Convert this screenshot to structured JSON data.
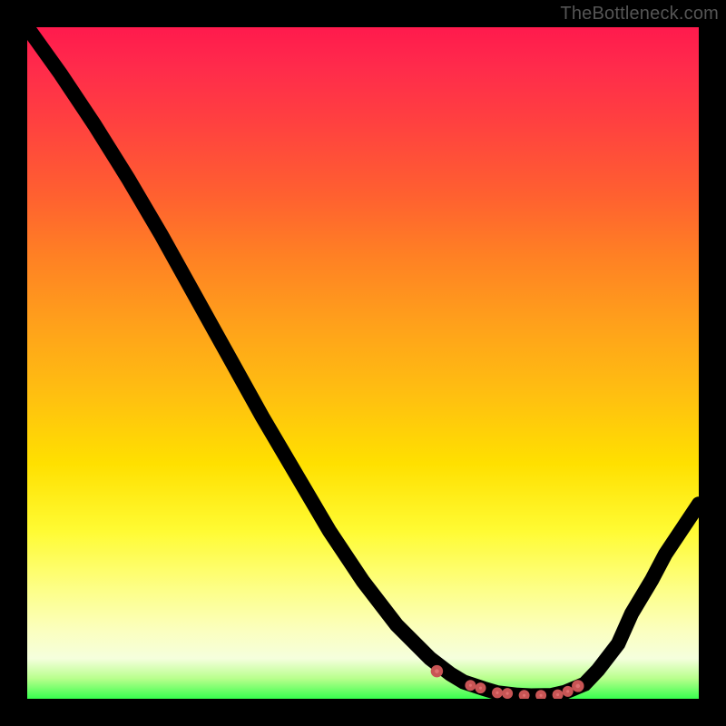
{
  "watermark": "TheBottleneck.com",
  "colors": {
    "background": "#000000",
    "curve_stroke": "#000000",
    "dot_fill": "#e07070",
    "dot_stroke": "#c85555",
    "gradient_top": "#ff1a4d",
    "gradient_bottom": "#37ff4e"
  },
  "chart_data": {
    "type": "line",
    "title": "",
    "xlabel": "",
    "ylabel": "",
    "xlim": [
      0,
      100
    ],
    "ylim": [
      0,
      100
    ],
    "grid": false,
    "legend": false,
    "x": [
      0,
      5,
      10,
      15,
      20,
      25,
      30,
      35,
      40,
      45,
      50,
      55,
      60,
      63,
      65,
      68,
      70,
      73,
      75,
      78,
      80,
      83,
      85,
      88,
      90,
      93,
      95,
      98,
      100
    ],
    "y": [
      100,
      93,
      85.5,
      77.5,
      69,
      60,
      51,
      42,
      33.5,
      25,
      17.5,
      11,
      6,
      3.7,
      2.5,
      1.5,
      0.9,
      0.55,
      0.45,
      0.5,
      0.95,
      2.2,
      4.3,
      8.2,
      12.7,
      17.7,
      21.5,
      26,
      29
    ],
    "markers": {
      "x": [
        61,
        66,
        67.5,
        70,
        71.5,
        74,
        76.5,
        79,
        80.5,
        82
      ],
      "y": [
        4.1,
        2.0,
        1.6,
        0.9,
        0.8,
        0.5,
        0.5,
        0.6,
        1.1,
        1.9
      ],
      "r": [
        4.5,
        3.8,
        3.8,
        3.8,
        3.8,
        3.8,
        3.8,
        3.8,
        3.8,
        4.5
      ]
    }
  }
}
